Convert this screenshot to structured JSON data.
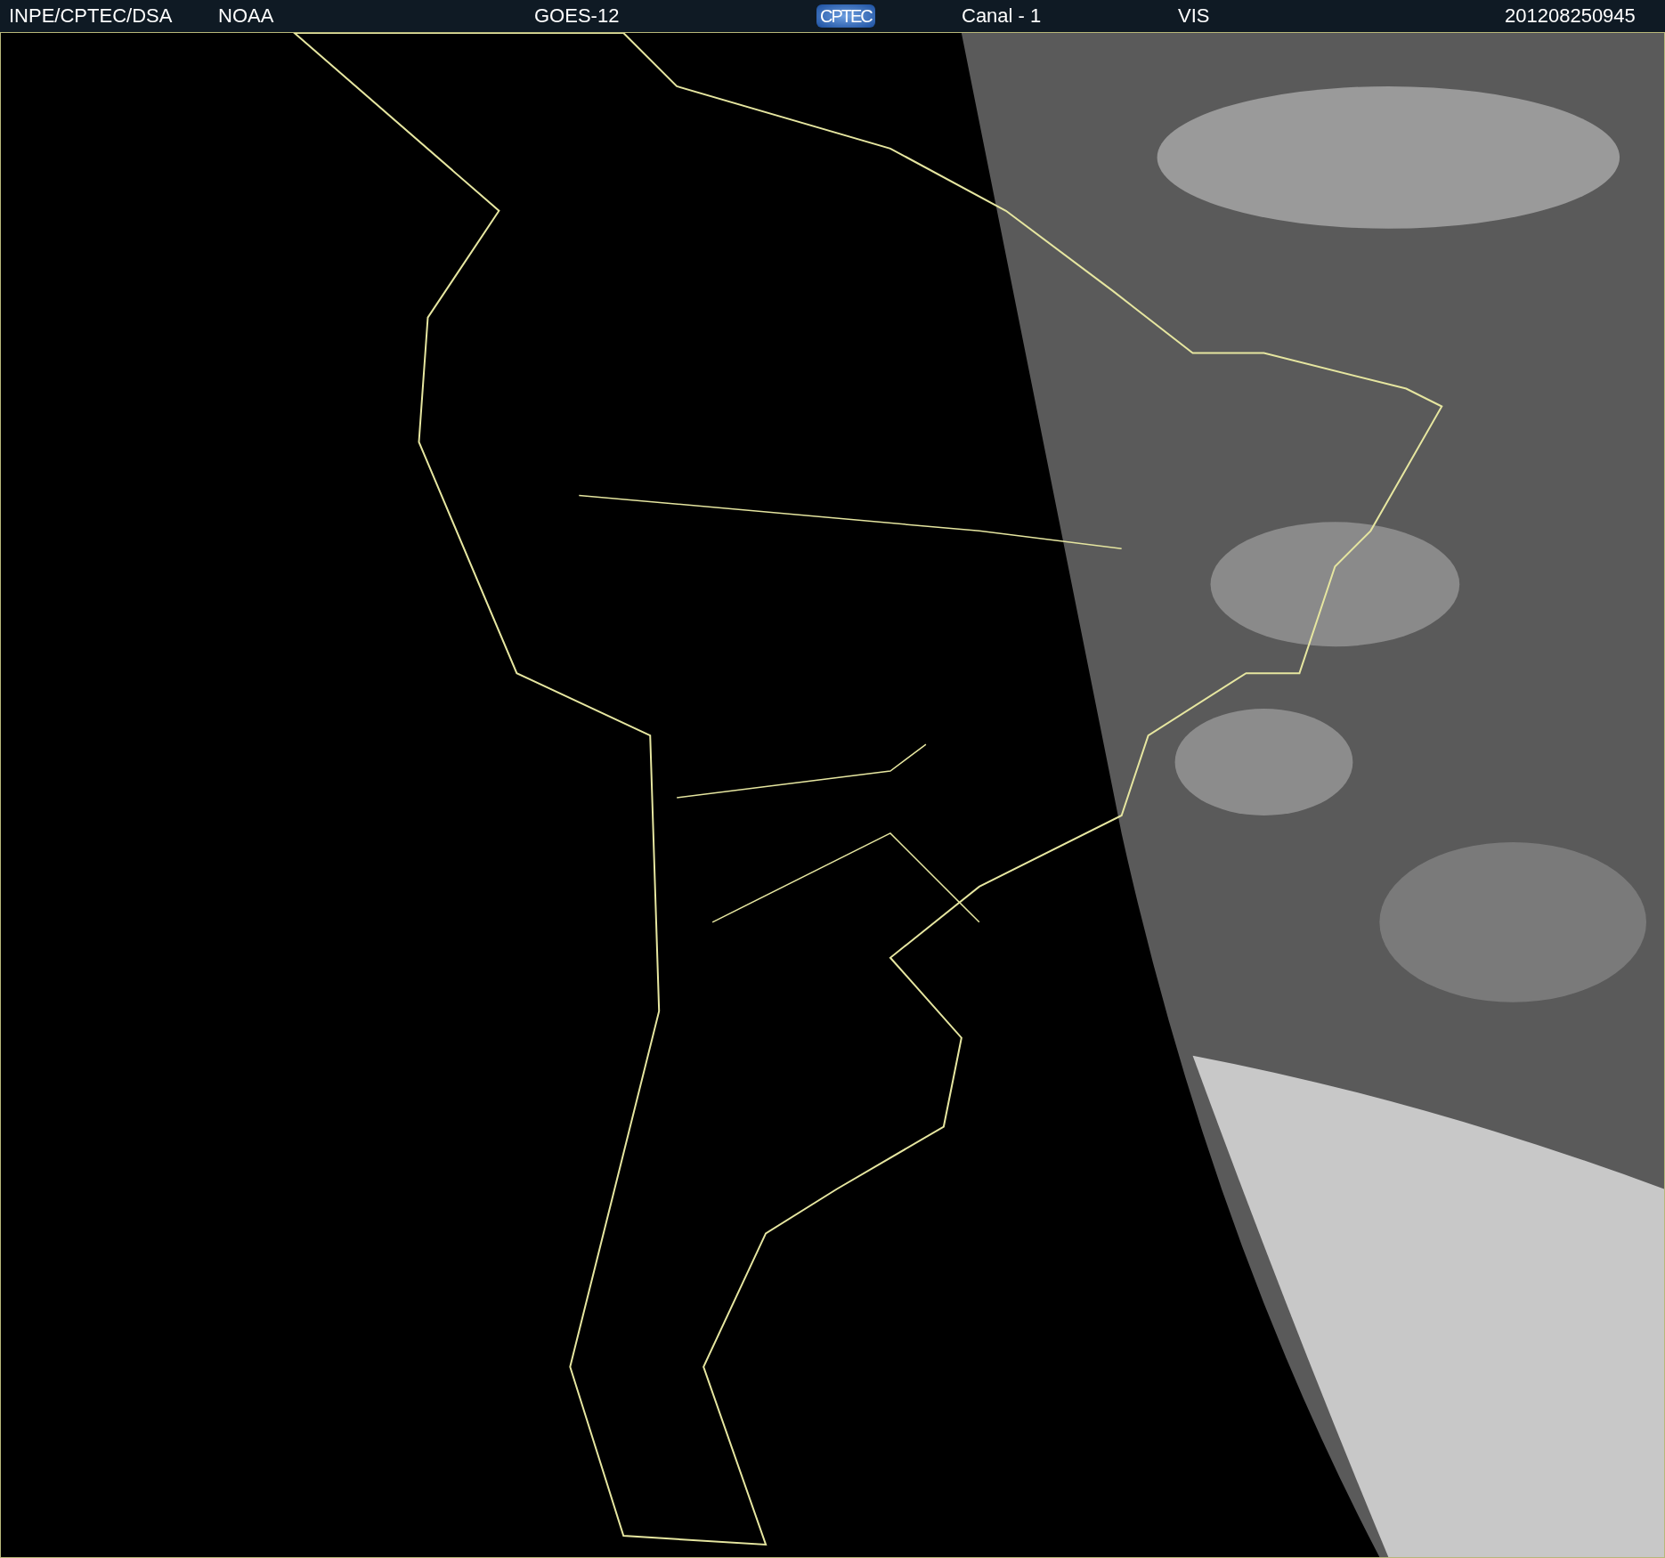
{
  "header": {
    "items": [
      {
        "kind": "text",
        "text": "INPE/CPTEC/DSA"
      },
      {
        "kind": "text",
        "text": "NOAA"
      },
      {
        "kind": "text",
        "text": "GOES-12"
      },
      {
        "kind": "logo",
        "text": "CPTEC"
      },
      {
        "kind": "text",
        "text": "Canal - 1"
      },
      {
        "kind": "text",
        "text": "VIS"
      },
      {
        "kind": "text",
        "text": "201208250945"
      }
    ]
  }
}
